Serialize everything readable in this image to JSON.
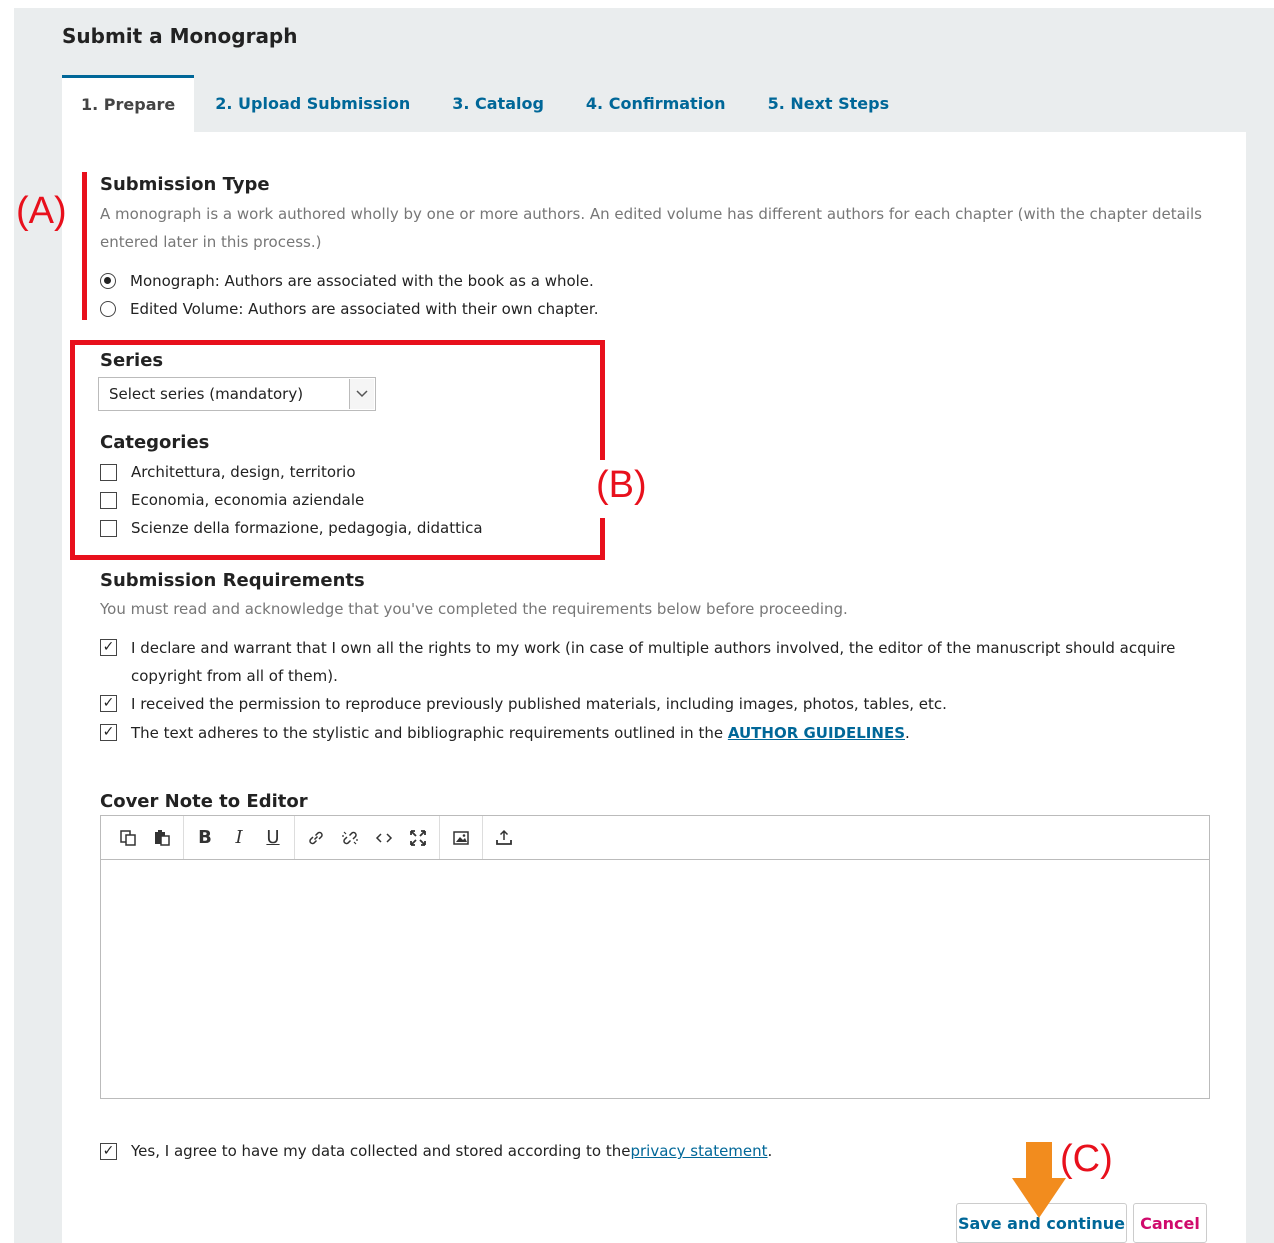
{
  "page": {
    "title": "Submit a Monograph"
  },
  "tabs": [
    {
      "label": "1. Prepare",
      "active": true
    },
    {
      "label": "2. Upload Submission",
      "active": false
    },
    {
      "label": "3. Catalog",
      "active": false
    },
    {
      "label": "4. Confirmation",
      "active": false
    },
    {
      "label": "5. Next Steps",
      "active": false
    }
  ],
  "submission_type": {
    "label": "Submission Type",
    "description": "A monograph is a work authored wholly by one or more authors. An edited volume has different authors for each chapter (with the chapter details entered later in this process.)",
    "options": [
      {
        "label": "Monograph: Authors are associated with the book as a whole.",
        "selected": true
      },
      {
        "label": "Edited Volume: Authors are associated with their own chapter.",
        "selected": false
      }
    ]
  },
  "series": {
    "label": "Series",
    "selected_value": "Select series (mandatory)"
  },
  "categories": {
    "label": "Categories",
    "items": [
      {
        "label": "Architettura, design, territorio",
        "checked": false
      },
      {
        "label": "Economia, economia aziendale",
        "checked": false
      },
      {
        "label": "Scienze della formazione, pedagogia, didattica",
        "checked": false
      }
    ]
  },
  "requirements": {
    "label": "Submission Requirements",
    "description": "You must read and acknowledge that you've completed the requirements below before proceeding.",
    "items": [
      {
        "text": "I declare and warrant that I own all the rights to my work (in case of multiple authors involved, the editor of the manuscript should acquire copyright from all of them).",
        "checked": true
      },
      {
        "text": "I received the permission to reproduce previously published materials, including images, photos, tables, etc.",
        "checked": true
      },
      {
        "text_before": "The text adheres to the stylistic and bibliographic requirements outlined in the ",
        "link": "AUTHOR GUIDELINES",
        "text_after": ".",
        "checked": true
      }
    ]
  },
  "cover_note": {
    "label": "Cover Note to Editor",
    "toolbar": [
      "copy-icon",
      "paste-icon",
      "bold-icon",
      "italic-icon",
      "underline-icon",
      "link-icon",
      "unlink-icon",
      "code-icon",
      "fullscreen-icon",
      "image-icon",
      "upload-icon"
    ],
    "toolbar_text": {
      "bold": "B",
      "italic": "I",
      "underline": "U"
    }
  },
  "privacy": {
    "text_before": "Yes, I agree to have my data collected and stored according to the ",
    "link": "privacy statement",
    "text_after": ".",
    "checked": true
  },
  "buttons": {
    "save": "Save and continue",
    "cancel": "Cancel"
  },
  "annotations": {
    "a": "(A)",
    "b": "(B)",
    "c": "(C)"
  },
  "colors": {
    "link": "#006798",
    "cancel": "#d00a6c",
    "annotation": "#e8101c",
    "arrow": "#f28c1e"
  }
}
